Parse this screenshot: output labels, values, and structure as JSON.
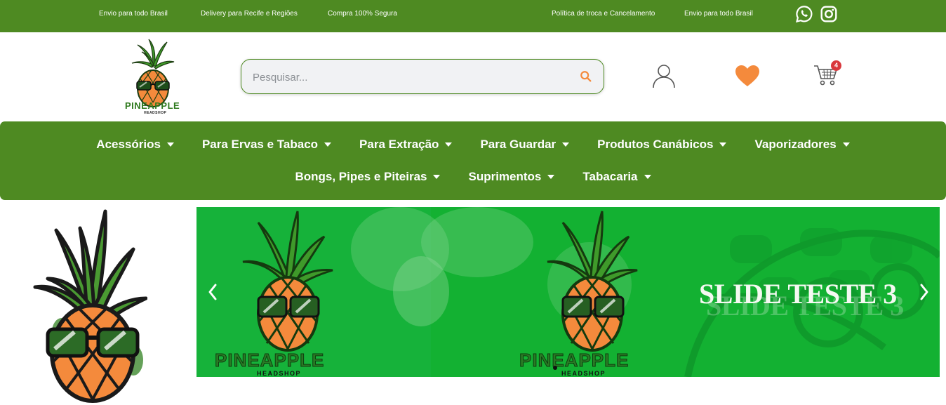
{
  "topbar": {
    "items": [
      "Envio para todo Brasil",
      "Delivery para Recife e Regiões",
      "Compra 100% Segura",
      "Política de troca e Cancelamento",
      "Envio para todo Brasil"
    ],
    "social": [
      "whatsapp-icon",
      "instagram-icon"
    ]
  },
  "header": {
    "logo_text": "PINEAPPLE",
    "logo_sub": "HEADSHOP",
    "search_placeholder": "Pesquisar...",
    "cart_count": "4"
  },
  "nav": {
    "row1": [
      "Acessórios",
      "Para Ervas e Tabaco",
      "Para Extração",
      "Para Guardar",
      "Produtos Canábicos",
      "Vaporizadores"
    ],
    "row2": [
      "Bongs, Pipes e Piteiras",
      "Suprimentos",
      "Tabacaria"
    ]
  },
  "slider": {
    "title": "SLIDE TESTE 3",
    "brand": "PINEAPPLE",
    "brand_sub": "HEADSHOP"
  },
  "colors": {
    "brand_green": "#4e8a22",
    "slider_green": "#1aa93a",
    "accent_orange": "#f48a3c",
    "badge_red": "#d9373c"
  }
}
